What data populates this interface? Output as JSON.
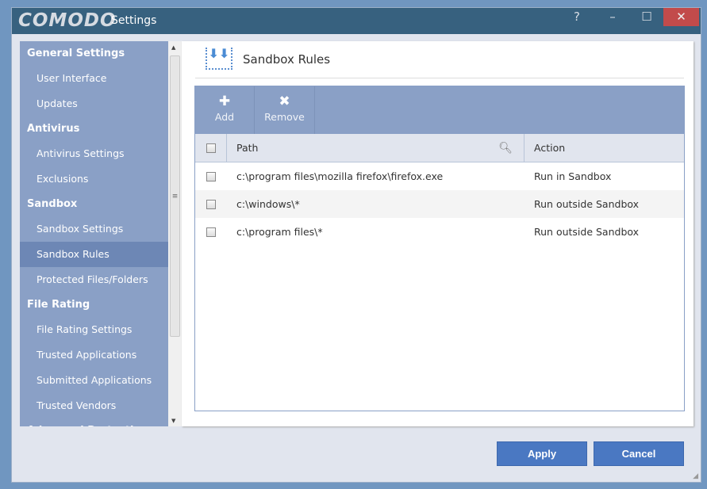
{
  "window": {
    "logo": "COMODO",
    "title": "Settings",
    "help": "?",
    "minimize": "–",
    "maximize": "☐",
    "close": "✕"
  },
  "sidebar": {
    "sections": [
      {
        "label": "General Settings",
        "items": [
          "User Interface",
          "Updates"
        ]
      },
      {
        "label": "Antivirus",
        "items": [
          "Antivirus Settings",
          "Exclusions"
        ]
      },
      {
        "label": "Sandbox",
        "items": [
          "Sandbox Settings",
          "Sandbox Rules",
          "Protected Files/Folders"
        ]
      },
      {
        "label": "File Rating",
        "items": [
          "File Rating Settings",
          "Trusted Applications",
          "Submitted Applications",
          "Trusted Vendors"
        ]
      },
      {
        "label": "Advanced Protection",
        "items": []
      }
    ],
    "active": "Sandbox Rules"
  },
  "page": {
    "title": "Sandbox Rules"
  },
  "toolbar": {
    "add": "Add",
    "remove": "Remove"
  },
  "table": {
    "columns": [
      "Path",
      "Action"
    ],
    "rows": [
      {
        "path": "c:\\program files\\mozilla firefox\\firefox.exe",
        "action": "Run in Sandbox"
      },
      {
        "path": "c:\\windows\\*",
        "action": "Run outside Sandbox"
      },
      {
        "path": "c:\\program files\\*",
        "action": "Run outside Sandbox"
      }
    ]
  },
  "footer": {
    "apply": "Apply",
    "cancel": "Cancel"
  }
}
